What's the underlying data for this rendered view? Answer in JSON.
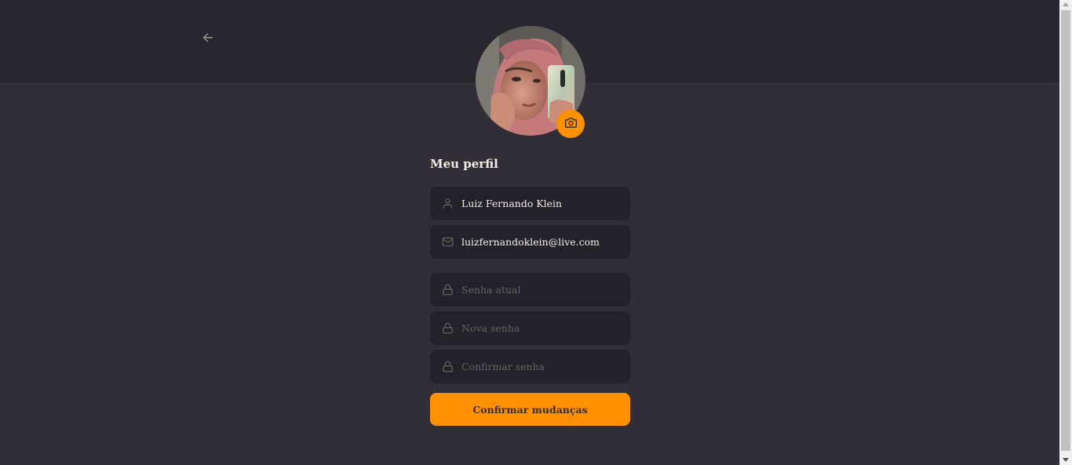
{
  "header": {
    "back_icon": "arrow-left-icon"
  },
  "profile": {
    "avatar_alt": "Luiz Fernando Klein",
    "camera_icon": "camera-icon"
  },
  "form": {
    "title": "Meu perfil",
    "name": {
      "icon": "user-icon",
      "value": "Luiz Fernando Klein",
      "placeholder": "Nome"
    },
    "email": {
      "icon": "mail-icon",
      "value": "luizfernandoklein@live.com",
      "placeholder": "E-mail"
    },
    "current_password": {
      "icon": "lock-icon",
      "value": "",
      "placeholder": "Senha atual"
    },
    "new_password": {
      "icon": "lock-icon",
      "value": "",
      "placeholder": "Nova senha"
    },
    "confirm_password": {
      "icon": "lock-icon",
      "value": "",
      "placeholder": "Confirmar senha"
    },
    "submit_label": "Confirmar mudanças"
  },
  "colors": {
    "background": "#312e38",
    "header": "#28262e",
    "input": "#232129",
    "accent": "#ff9000",
    "text": "#f4ede8",
    "placeholder": "#666360"
  }
}
